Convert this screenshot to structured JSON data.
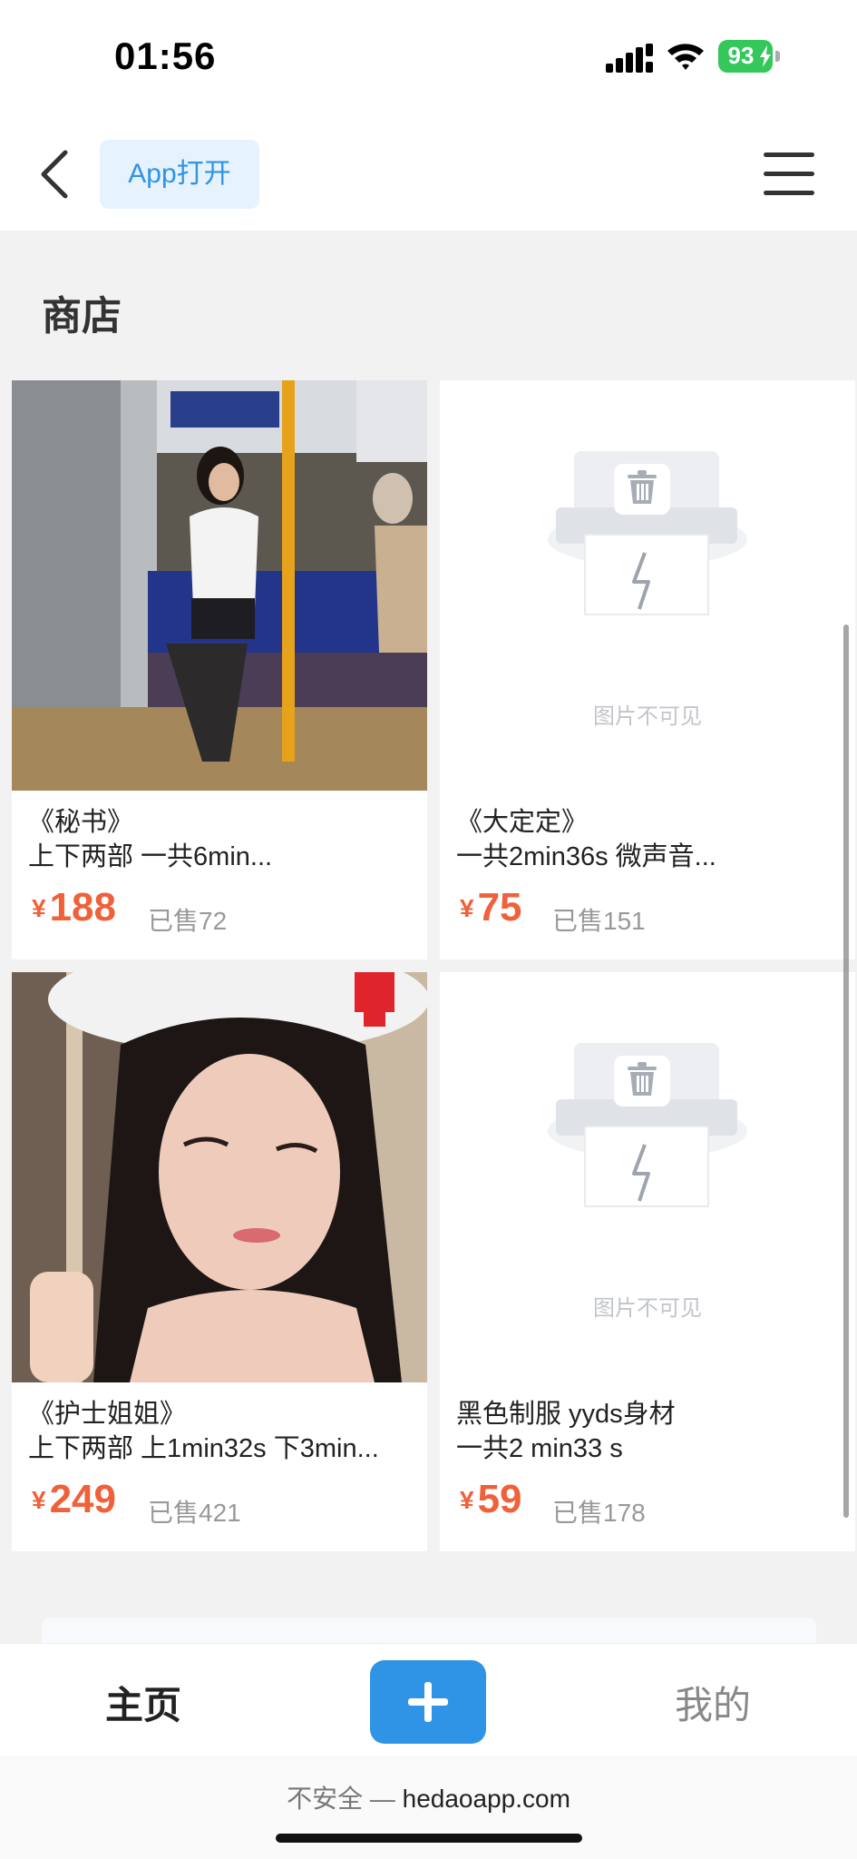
{
  "status_bar": {
    "time": "01:56",
    "battery_percent": "93",
    "icons": [
      "cellular-signal-icon",
      "wifi-icon",
      "battery-charging-icon"
    ]
  },
  "nav": {
    "back_icon": "chevron-left-icon",
    "app_open_label": "App打开",
    "menu_icon": "hamburger-menu-icon"
  },
  "section_title": "商店",
  "products": [
    {
      "title_line1": "《秘书》",
      "title_line2": "上下两部 一共6min...",
      "currency": "¥",
      "price": "188",
      "sold": "已售72",
      "image": "photo"
    },
    {
      "title_line1": "《大定定》",
      "title_line2": "一共2min36s 微声音...",
      "currency": "¥",
      "price": "75",
      "sold": "已售151",
      "image": "unavailable",
      "image_caption": "图片不可见"
    },
    {
      "title_line1": "《护士姐姐》",
      "title_line2": "上下两部 上1min32s 下3min...",
      "currency": "¥",
      "price": "249",
      "sold": "已售421",
      "image": "photo"
    },
    {
      "title_line1": "黑色制服 yyds身材",
      "title_line2": "一共2 min33 s",
      "currency": "¥",
      "price": "59",
      "sold": "已售178",
      "image": "unavailable",
      "image_caption": "图片不可见"
    }
  ],
  "tab_bar": {
    "home_label": "主页",
    "add_icon": "plus-icon",
    "mine_label": "我的"
  },
  "browser": {
    "insecure_label": "不安全 —",
    "domain": "hedaoapp.com"
  },
  "colors": {
    "accent": "#2f93e6",
    "price": "#f0613a",
    "battery": "#34c759"
  }
}
